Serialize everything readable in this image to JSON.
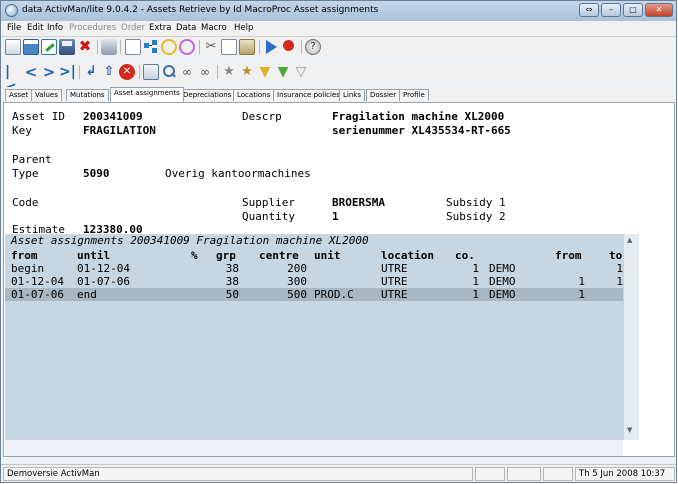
{
  "window": {
    "title": "data ActivMan/lite 9.0.4.2 - Assets Retrieve by Id MacroProc Asset assignments"
  },
  "menu": [
    {
      "label": "File",
      "enabled": true
    },
    {
      "label": "Edit",
      "enabled": true
    },
    {
      "label": "Info",
      "enabled": true
    },
    {
      "label": "Procedures",
      "enabled": false
    },
    {
      "label": "Order",
      "enabled": false
    },
    {
      "label": "Extra",
      "enabled": true
    },
    {
      "label": "Data",
      "enabled": true
    },
    {
      "label": "Macro",
      "enabled": true
    },
    {
      "label": "Help",
      "enabled": true
    }
  ],
  "tabs": [
    "Asset",
    "Values",
    "Mutations",
    "Asset assignments",
    "Depreciations",
    "Locations",
    "Insurance policies",
    "Links",
    "Dossier",
    "Profile"
  ],
  "active_tab": "Asset assignments",
  "asset": {
    "asset_id_label": "Asset ID",
    "asset_id": "200341009",
    "key_label": "Key",
    "key": "FRAGILATION",
    "descrp_label": "Descrp",
    "descrp_line1": "Fragilation machine XL2000",
    "descrp_line2": "serienummer XL435534-RT-665",
    "parent_label": "Parent",
    "type_label": "Type",
    "type_code": "5090",
    "type_desc": "Overig kantoormachines",
    "code_label": "Code",
    "supplier_label": "Supplier",
    "supplier": "BROERSMA",
    "quantity_label": "Quantity",
    "quantity": "1",
    "subsidy1_label": "Subsidy 1",
    "subsidy2_label": "Subsidy 2",
    "estimate_label": "Estimate",
    "estimate": "123380.00"
  },
  "grid": {
    "title": "Asset assignments 200341009 Fragilation machine XL2000",
    "headers": {
      "from": "from",
      "until": "until",
      "pct": "%",
      "grp": "grp",
      "centre": "centre",
      "unit": "unit",
      "location": "location",
      "co": "co.",
      "from2": "from",
      "to": "to"
    },
    "rows": [
      {
        "from": "begin",
        "until": "01-12-04",
        "pct": "",
        "grp": "38",
        "centre": "200",
        "unit": "",
        "location": "UTRE",
        "qty": "1",
        "co": "DEMO",
        "from2": "",
        "to": "1"
      },
      {
        "from": "01-12-04",
        "until": "01-07-06",
        "pct": "",
        "grp": "38",
        "centre": "300",
        "unit": "",
        "location": "UTRE",
        "qty": "1",
        "co": "DEMO",
        "from2": "1",
        "to": "1"
      },
      {
        "from": "01-07-06",
        "until": "end",
        "pct": "",
        "grp": "50",
        "centre": "500",
        "unit": "PROD.C",
        "location": "UTRE",
        "qty": "1",
        "co": "DEMO",
        "from2": "1",
        "to": ""
      }
    ],
    "selected_row": 2
  },
  "status": {
    "left": "Demoversie ActivMan",
    "datetime": "Th 5 Jun 2008 10:37"
  }
}
